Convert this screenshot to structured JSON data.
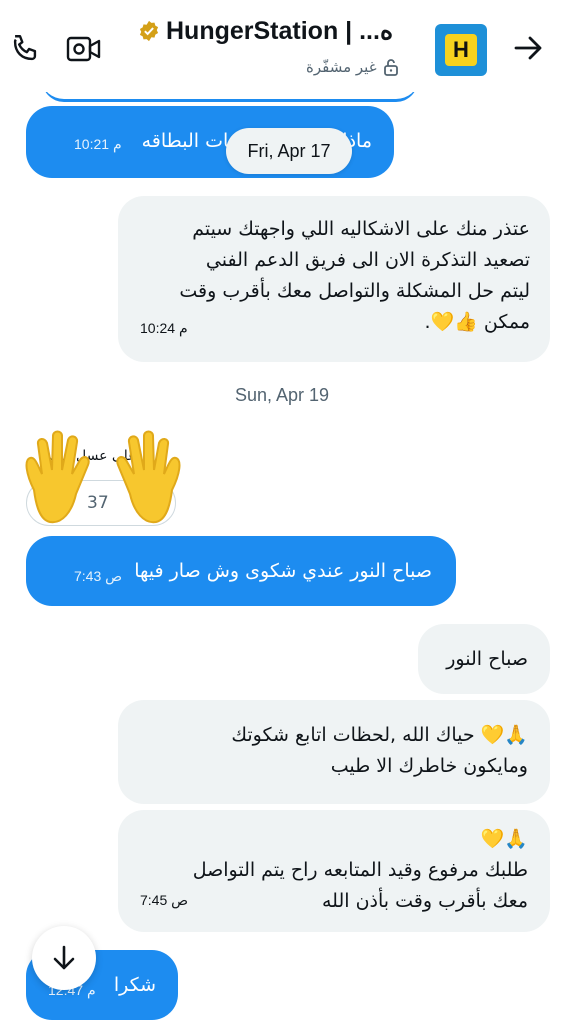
{
  "header": {
    "title": "HungerStation | ...ه",
    "subtitle": "غير مشفّرة",
    "avatar_letter": "H",
    "icons": {
      "back": "arrow-right-icon",
      "call": "phone-icon",
      "video": "video-camera-icon",
      "lock": "lock-open-icon",
      "verified": "verified-badge-icon"
    }
  },
  "messages": [
    {
      "text": "ماذا تعمل على بيانات البطاقه",
      "time": "10:21 م",
      "side": "out"
    },
    {
      "text": "عتذر منك على الاشكاليه اللي واجهتك سيتم\nتصعيد التذكرة الان الى فريق الدعم الفني\nليتم حل المشكلة والتواصل معك بأقرب وقت\nممكن 👍💛.",
      "time": "10:24 م",
      "side": "in"
    },
    {
      "text": "صباح النور عندي شكوى وش صار فيها",
      "time": "7:43 ص",
      "side": "out"
    },
    {
      "text": "صباح النور",
      "time": "",
      "side": "in"
    },
    {
      "text": "🙏💛 حياك الله ,لحظات اتابع شكوتك\nومايكون خاطرك الا طيب",
      "time": "",
      "side": "in"
    },
    {
      "text": "🙏💛\nطلبك مرفوع وقيد المتابعه راح يتم التواصل\nمعك بأقرب وقت بأذن الله",
      "time": "7:45 ص",
      "side": "in"
    },
    {
      "text": "شكرا",
      "time": "12:47 م",
      "side": "out"
    }
  ],
  "dates": {
    "floating": "Fri, Apr 17",
    "sep": "Sun, Apr 19"
  },
  "reaction": {
    "partial_text": "على عسل ملكي",
    "chip_text": "37",
    "emoji": "👋"
  },
  "colors": {
    "outgoing": "#1d8cf0",
    "incoming": "#eff3f4",
    "verified": "#d4a017",
    "avatar_bg": "#1e90d8",
    "avatar_fg": "#f7d21e"
  },
  "scroll": {
    "icon": "arrow-down-icon"
  }
}
